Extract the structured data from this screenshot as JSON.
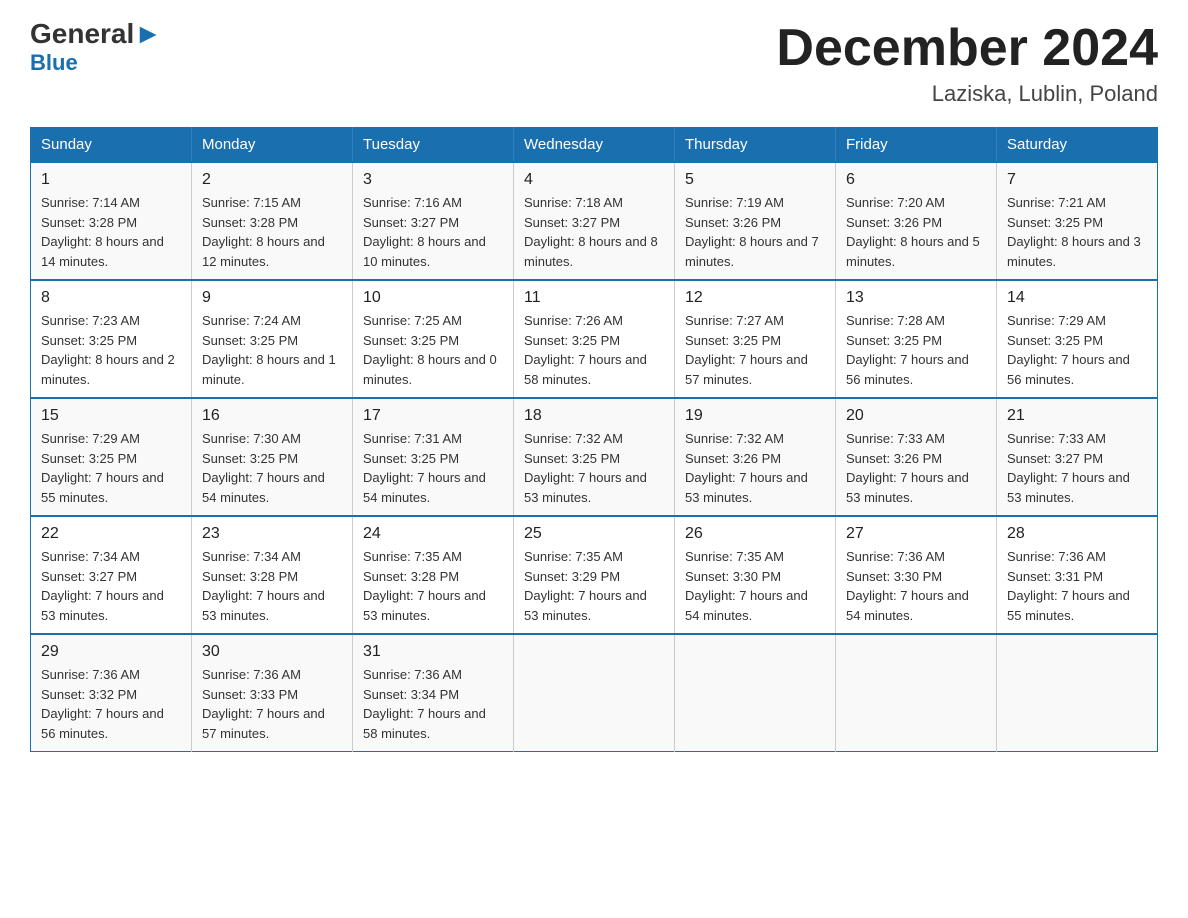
{
  "header": {
    "logo": {
      "general": "General",
      "triangle": "▶",
      "blue": "Blue"
    },
    "title": "December 2024",
    "subtitle": "Laziska, Lublin, Poland"
  },
  "columns": [
    "Sunday",
    "Monday",
    "Tuesday",
    "Wednesday",
    "Thursday",
    "Friday",
    "Saturday"
  ],
  "weeks": [
    [
      {
        "day": "1",
        "sunrise": "7:14 AM",
        "sunset": "3:28 PM",
        "daylight": "8 hours and 14 minutes."
      },
      {
        "day": "2",
        "sunrise": "7:15 AM",
        "sunset": "3:28 PM",
        "daylight": "8 hours and 12 minutes."
      },
      {
        "day": "3",
        "sunrise": "7:16 AM",
        "sunset": "3:27 PM",
        "daylight": "8 hours and 10 minutes."
      },
      {
        "day": "4",
        "sunrise": "7:18 AM",
        "sunset": "3:27 PM",
        "daylight": "8 hours and 8 minutes."
      },
      {
        "day": "5",
        "sunrise": "7:19 AM",
        "sunset": "3:26 PM",
        "daylight": "8 hours and 7 minutes."
      },
      {
        "day": "6",
        "sunrise": "7:20 AM",
        "sunset": "3:26 PM",
        "daylight": "8 hours and 5 minutes."
      },
      {
        "day": "7",
        "sunrise": "7:21 AM",
        "sunset": "3:25 PM",
        "daylight": "8 hours and 3 minutes."
      }
    ],
    [
      {
        "day": "8",
        "sunrise": "7:23 AM",
        "sunset": "3:25 PM",
        "daylight": "8 hours and 2 minutes."
      },
      {
        "day": "9",
        "sunrise": "7:24 AM",
        "sunset": "3:25 PM",
        "daylight": "8 hours and 1 minute."
      },
      {
        "day": "10",
        "sunrise": "7:25 AM",
        "sunset": "3:25 PM",
        "daylight": "8 hours and 0 minutes."
      },
      {
        "day": "11",
        "sunrise": "7:26 AM",
        "sunset": "3:25 PM",
        "daylight": "7 hours and 58 minutes."
      },
      {
        "day": "12",
        "sunrise": "7:27 AM",
        "sunset": "3:25 PM",
        "daylight": "7 hours and 57 minutes."
      },
      {
        "day": "13",
        "sunrise": "7:28 AM",
        "sunset": "3:25 PM",
        "daylight": "7 hours and 56 minutes."
      },
      {
        "day": "14",
        "sunrise": "7:29 AM",
        "sunset": "3:25 PM",
        "daylight": "7 hours and 56 minutes."
      }
    ],
    [
      {
        "day": "15",
        "sunrise": "7:29 AM",
        "sunset": "3:25 PM",
        "daylight": "7 hours and 55 minutes."
      },
      {
        "day": "16",
        "sunrise": "7:30 AM",
        "sunset": "3:25 PM",
        "daylight": "7 hours and 54 minutes."
      },
      {
        "day": "17",
        "sunrise": "7:31 AM",
        "sunset": "3:25 PM",
        "daylight": "7 hours and 54 minutes."
      },
      {
        "day": "18",
        "sunrise": "7:32 AM",
        "sunset": "3:25 PM",
        "daylight": "7 hours and 53 minutes."
      },
      {
        "day": "19",
        "sunrise": "7:32 AM",
        "sunset": "3:26 PM",
        "daylight": "7 hours and 53 minutes."
      },
      {
        "day": "20",
        "sunrise": "7:33 AM",
        "sunset": "3:26 PM",
        "daylight": "7 hours and 53 minutes."
      },
      {
        "day": "21",
        "sunrise": "7:33 AM",
        "sunset": "3:27 PM",
        "daylight": "7 hours and 53 minutes."
      }
    ],
    [
      {
        "day": "22",
        "sunrise": "7:34 AM",
        "sunset": "3:27 PM",
        "daylight": "7 hours and 53 minutes."
      },
      {
        "day": "23",
        "sunrise": "7:34 AM",
        "sunset": "3:28 PM",
        "daylight": "7 hours and 53 minutes."
      },
      {
        "day": "24",
        "sunrise": "7:35 AM",
        "sunset": "3:28 PM",
        "daylight": "7 hours and 53 minutes."
      },
      {
        "day": "25",
        "sunrise": "7:35 AM",
        "sunset": "3:29 PM",
        "daylight": "7 hours and 53 minutes."
      },
      {
        "day": "26",
        "sunrise": "7:35 AM",
        "sunset": "3:30 PM",
        "daylight": "7 hours and 54 minutes."
      },
      {
        "day": "27",
        "sunrise": "7:36 AM",
        "sunset": "3:30 PM",
        "daylight": "7 hours and 54 minutes."
      },
      {
        "day": "28",
        "sunrise": "7:36 AM",
        "sunset": "3:31 PM",
        "daylight": "7 hours and 55 minutes."
      }
    ],
    [
      {
        "day": "29",
        "sunrise": "7:36 AM",
        "sunset": "3:32 PM",
        "daylight": "7 hours and 56 minutes."
      },
      {
        "day": "30",
        "sunrise": "7:36 AM",
        "sunset": "3:33 PM",
        "daylight": "7 hours and 57 minutes."
      },
      {
        "day": "31",
        "sunrise": "7:36 AM",
        "sunset": "3:34 PM",
        "daylight": "7 hours and 58 minutes."
      },
      null,
      null,
      null,
      null
    ]
  ],
  "labels": {
    "sunrise": "Sunrise:",
    "sunset": "Sunset:",
    "daylight": "Daylight:"
  }
}
